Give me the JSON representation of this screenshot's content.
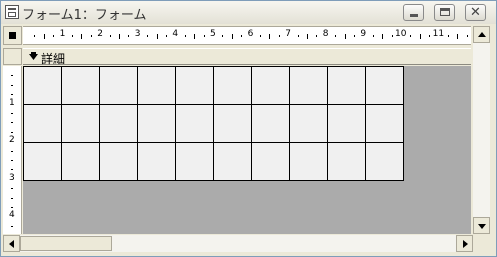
{
  "window": {
    "title": "フォーム1：フォーム",
    "controls": [
      "minimize-icon",
      "maximize-icon",
      "close-icon"
    ],
    "close_glyph": "✕"
  },
  "ruler": {
    "horizontal_labels": [
      "1",
      "2",
      "3",
      "4",
      "5",
      "6",
      "7",
      "8",
      "9",
      "10",
      "11"
    ],
    "vertical_labels": [
      "1",
      "2",
      "3",
      "4"
    ]
  },
  "section": {
    "label": "詳細",
    "arrow_icon": "down-arrow-icon"
  },
  "grid": {
    "rows": 3,
    "columns": 10
  },
  "colors": {
    "canvas_background": "#ababab",
    "grid_cell": "#f0f0f0",
    "grid_line": "#000000"
  }
}
